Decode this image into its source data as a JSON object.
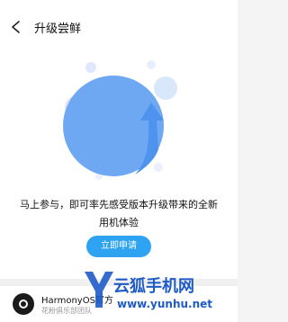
{
  "status_bar": {
    "left": "",
    "right": ""
  },
  "header": {
    "title": "升级尝鲜"
  },
  "hero": {
    "headline_line1": "马上参与，即可率先感受版本升级带来的全新",
    "headline_line2": "用机体验",
    "cta_label": "立即申请"
  },
  "author": {
    "name": "HarmonyOS官方",
    "team": "花粉俱乐部团队"
  },
  "colors": {
    "accent": "#2ea3f2"
  },
  "watermark": {
    "brand": "云狐手机网",
    "url": "www.yunhu.net"
  }
}
